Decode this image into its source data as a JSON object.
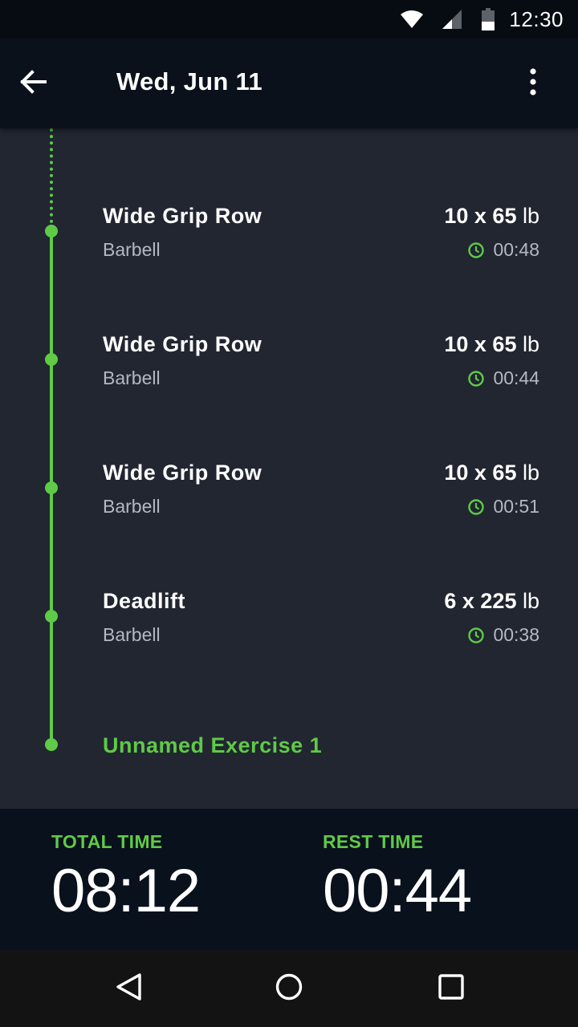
{
  "status_bar": {
    "time": "12:30",
    "icons": [
      "wifi-icon",
      "signal-icon",
      "battery-icon"
    ]
  },
  "app_bar": {
    "title": "Wed, Jun 11",
    "back_icon": "arrow-left-icon",
    "menu_icon": "more-vert-icon"
  },
  "entries": [
    {
      "name": "Wide Grip Row",
      "equipment": "Barbell",
      "reps": "10",
      "weight": "65",
      "unit": "lb",
      "rest": "00:48"
    },
    {
      "name": "Wide Grip Row",
      "equipment": "Barbell",
      "reps": "10",
      "weight": "65",
      "unit": "lb",
      "rest": "00:44"
    },
    {
      "name": "Wide Grip Row",
      "equipment": "Barbell",
      "reps": "10",
      "weight": "65",
      "unit": "lb",
      "rest": "00:51"
    },
    {
      "name": "Deadlift",
      "equipment": "Barbell",
      "reps": "6",
      "weight": "225",
      "unit": "lb",
      "rest": "00:38"
    }
  ],
  "next_exercise": "Unnamed Exercise 1",
  "footer": {
    "total_label": "TOTAL TIME",
    "total_value": "08:12",
    "rest_label": "REST TIME",
    "rest_value": "00:44"
  },
  "nav": {
    "icons": [
      "back-triangle-icon",
      "home-circle-icon",
      "recents-square-icon"
    ]
  },
  "colors": {
    "accent": "#5fca47",
    "background": "#212631",
    "app_bar": "#0a111b",
    "footer": "#08111c",
    "secondary_text": "#b3b8c2"
  }
}
